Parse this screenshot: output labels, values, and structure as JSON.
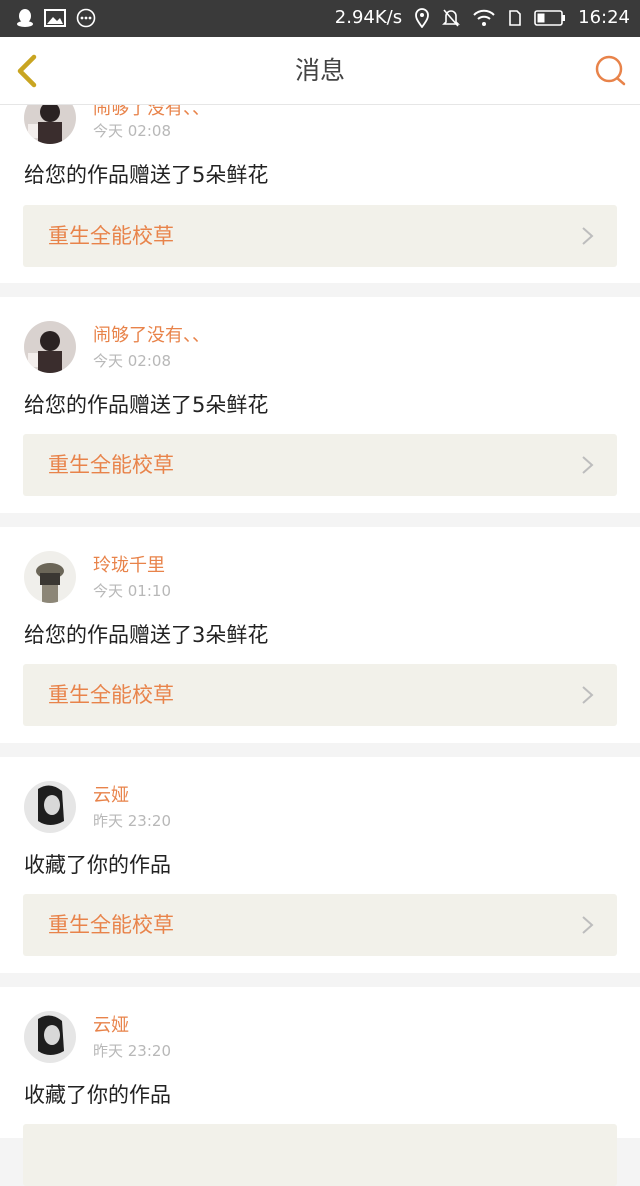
{
  "status_bar": {
    "network_speed": "2.94K/s",
    "time": "16:24"
  },
  "header": {
    "title": "消息"
  },
  "messages": [
    {
      "user": "闹够了没有、、",
      "time": "今天 02:08",
      "action": "给您的作品赠送了5朵鲜花",
      "work_title": "重生全能校草"
    },
    {
      "user": "闹够了没有、、",
      "time": "今天 02:08",
      "action": "给您的作品赠送了5朵鲜花",
      "work_title": "重生全能校草"
    },
    {
      "user": "玲珑千里",
      "time": "今天 01:10",
      "action": "给您的作品赠送了3朵鲜花",
      "work_title": "重生全能校草"
    },
    {
      "user": "云娅",
      "time": "昨天 23:20",
      "action": "收藏了你的作品",
      "work_title": "重生全能校草"
    },
    {
      "user": "云娅",
      "time": "昨天 23:20",
      "action": "收藏了你的作品",
      "work_title": ""
    }
  ],
  "colors": {
    "accent": "#e8834a",
    "back_arrow": "#c9a521",
    "work_bg": "#f2f1ea"
  }
}
